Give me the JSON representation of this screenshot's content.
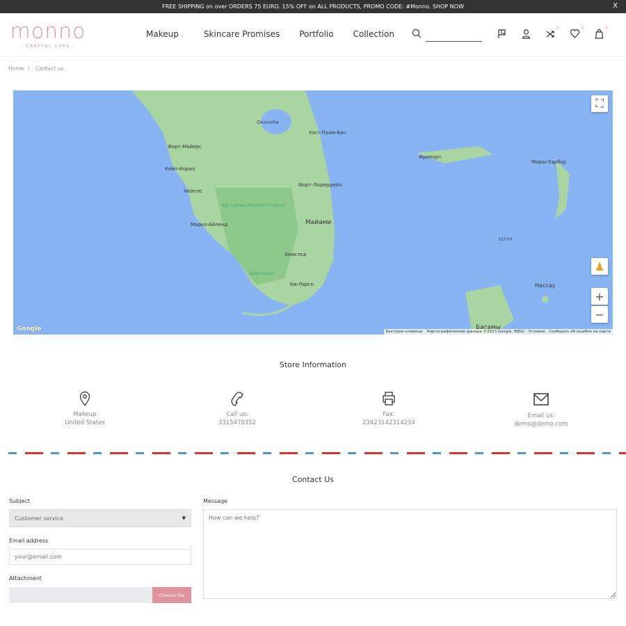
{
  "topbar": {
    "text": "FREE SHIPPING on over ORDERS 75 EURO. 15% OFF on ALL PRODUCTS, PROMO CODE: #Monno. SHOP NOW",
    "close": "X"
  },
  "logo": {
    "name": "monno",
    "tagline": "· CAREFUL CARE ·"
  },
  "nav": [
    "Makeup",
    "Skincare Promises",
    "Portfolio",
    "Collection"
  ],
  "header_counts": {
    "compare": "0",
    "wishlist": "0",
    "cart": "0"
  },
  "breadcrumb": [
    "Home",
    "Contact us"
  ],
  "map": {
    "labels": [
      "Форт-Майерс",
      "Кейп-Корал",
      "Нейплс",
      "Марко-Айленд",
      "Окичоби",
      "Уэст-Палм-Бич",
      "Форт-Лодердейл",
      "Майами",
      "Хомстед",
      "Ки-Ларго",
      "Big Cypress National Preserve",
      "Эверглейдс",
      "БЕРРИ",
      "Нассау",
      "Багамы",
      "Фрипорт",
      "Марш-Харбор"
    ],
    "google": "Google",
    "attribution": [
      "Быстрые клавиши",
      "Картографические данные ©2023 Google, INEGI",
      "Условия",
      "Сообщить об ошибке на карте"
    ],
    "colors": {
      "water": "#88b4f4",
      "land": "#a8d5a2",
      "park": "#8cc98a"
    }
  },
  "store": {
    "title": "Store Information",
    "items": [
      {
        "icon": "location-pin-icon",
        "line1": "Makeup",
        "line2": "United States"
      },
      {
        "icon": "phone-icon",
        "line1": "Call us:",
        "line2": "3315470352"
      },
      {
        "icon": "fax-icon",
        "line1": "Fax:",
        "line2": "23423142314234"
      },
      {
        "icon": "envelope-icon",
        "line1": "Email us:",
        "line2": "demo@demo.com"
      }
    ]
  },
  "contact": {
    "title": "Contact Us",
    "subject_label": "Subject",
    "subject_value": "Customer service",
    "email_label": "Email address",
    "email_placeholder": "your@email.com",
    "attachment_label": "Attachment",
    "choose_file": "Choose File",
    "message_label": "Message",
    "message_placeholder": "How can we help?"
  },
  "colors": {
    "accent": "#e0929d",
    "dash_blue": "#4a98cf",
    "dash_red": "#d8342c"
  }
}
